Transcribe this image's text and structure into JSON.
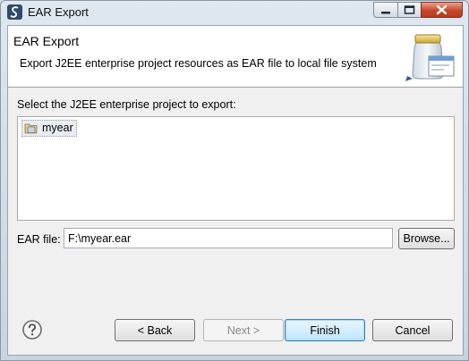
{
  "window": {
    "title": "EAR Export",
    "app_icon": "eclipse-s-icon"
  },
  "header": {
    "title": "EAR Export",
    "description": "Export J2EE enterprise project resources as EAR file to local file system",
    "illustration_icon": "jar-window-icon"
  },
  "project_section": {
    "label": "Select the J2EE enterprise project to export:",
    "items": [
      {
        "label": "myear",
        "icon": "enterprise-project-icon",
        "selected": true
      }
    ]
  },
  "ear_file": {
    "label": "EAR file:",
    "value": "F:\\myear.ear",
    "browse_label": "Browse..."
  },
  "footer": {
    "help_icon": "help-icon",
    "back_label": "< Back",
    "next_label": "Next >",
    "finish_label": "Finish",
    "cancel_label": "Cancel"
  }
}
